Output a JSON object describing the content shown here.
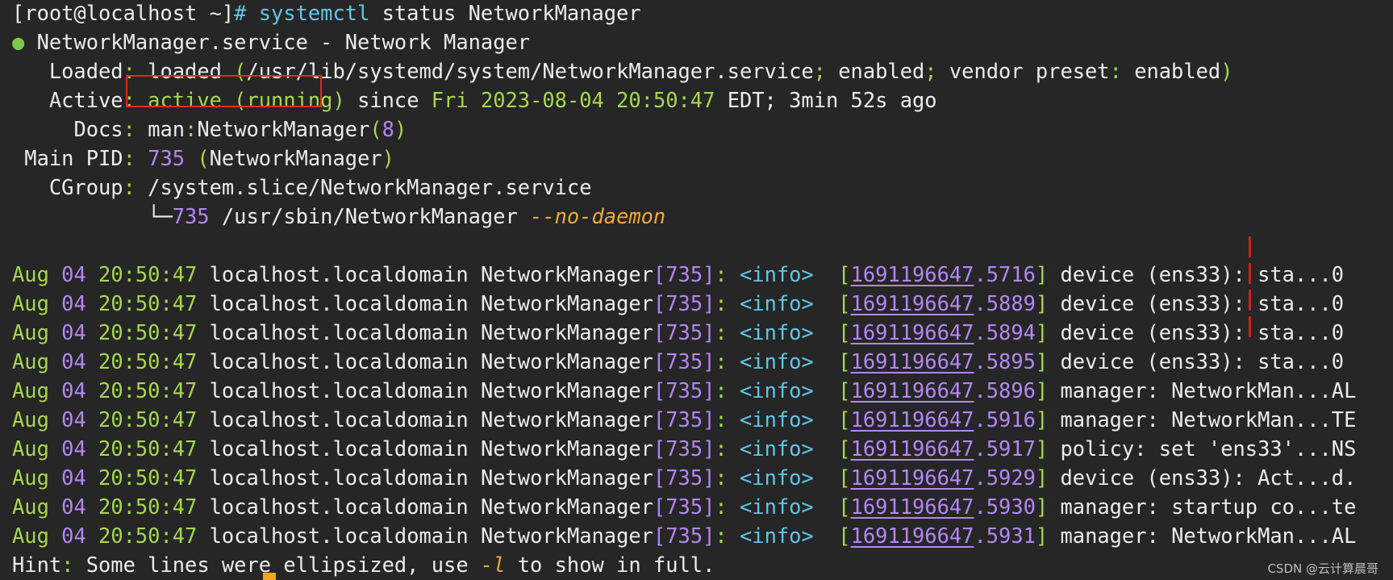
{
  "prompt": {
    "text": "[root@localhost ~]",
    "hash": "#",
    "cmd": "systemctl",
    "args": " status NetworkManager"
  },
  "unit": {
    "bullet": "●",
    "name": "NetworkManager.service - Network Manager"
  },
  "loaded": {
    "label": "Loaded",
    "colon": ":",
    "state": "loaded",
    "path": "/usr/lib/systemd/system/NetworkManager.service",
    "enabled1": "enabled",
    "vendor_label": "vendor preset",
    "enabled2": "enabled"
  },
  "active": {
    "label": "Active",
    "value": "active (running)",
    "since": "since",
    "date": "Fri 2023-08-04 20:50:47",
    "tz": "EDT; 3min 52s ago"
  },
  "docs": {
    "label": "Docs",
    "man_prefix": "man",
    "name": "NetworkManager",
    "section": "8"
  },
  "main_pid": {
    "label": "Main PID",
    "pid": "735",
    "name": "NetworkManager"
  },
  "cgroup": {
    "label": "CGroup",
    "path": "/system.slice/NetworkManager.service",
    "tree": "└─",
    "pid": "735",
    "bin": "/usr/sbin/NetworkManager",
    "flag": "--no-daemon"
  },
  "log_common": {
    "month": "Aug",
    "day": "04",
    "time": "20:50:47",
    "host": "localhost.localdomain",
    "proc": "NetworkManager",
    "pid": "735",
    "level": "<info>",
    "ts_int": "1691196647"
  },
  "logs": [
    {
      "frac": ".5716",
      "text": "device (ens33): sta...0"
    },
    {
      "frac": ".5889",
      "text": "device (ens33): sta...0"
    },
    {
      "frac": ".5894",
      "text": "device (ens33): sta...0"
    },
    {
      "frac": ".5895",
      "text": "device (ens33): sta...0"
    },
    {
      "frac": ".5896",
      "text": "manager: NetworkMan...AL"
    },
    {
      "frac": ".5916",
      "text": "manager: NetworkMan...TE"
    },
    {
      "frac": ".5917",
      "text": "policy: set 'ens33'...NS"
    },
    {
      "frac": ".5929",
      "text": "device (ens33): Act...d."
    },
    {
      "frac": ".5930",
      "text": "manager: startup co...te"
    },
    {
      "frac": ".5931",
      "text": "manager: NetworkMan...AL"
    }
  ],
  "hint": {
    "label": "Hint",
    "text1": " Some lines were ellipsized, use ",
    "flag": "-l",
    "text2": " to show in full."
  },
  "watermark": "CSDN @云计算晨哥",
  "colors": {
    "background": "#262626",
    "green": "#a6d84d",
    "purple": "#b486f5",
    "cyan": "#5fc6e9",
    "orange": "#f0a83a",
    "highlight_box": "#e6281c"
  }
}
